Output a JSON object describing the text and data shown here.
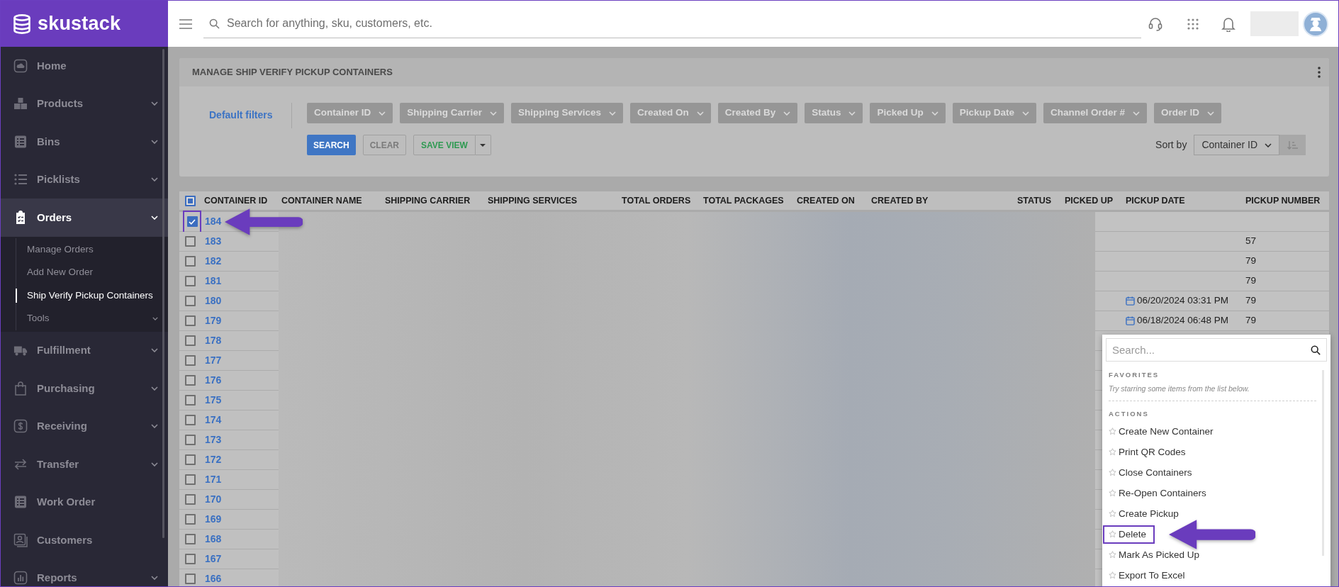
{
  "brand": {
    "name": "skustack"
  },
  "sidebar": {
    "items": [
      {
        "label": "Home",
        "kind": "link",
        "selected": false
      },
      {
        "label": "Products",
        "kind": "group",
        "selected": false
      },
      {
        "label": "Bins",
        "kind": "group",
        "selected": false
      },
      {
        "label": "Picklists",
        "kind": "group",
        "selected": false
      },
      {
        "label": "Orders",
        "kind": "group",
        "selected": true,
        "expanded": true,
        "children": [
          {
            "label": "Manage Orders",
            "kind": "link",
            "selected": false
          },
          {
            "label": "Add New Order",
            "kind": "link",
            "selected": false
          },
          {
            "label": "Ship Verify Pickup Containers",
            "kind": "link",
            "selected": true
          },
          {
            "label": "Tools",
            "kind": "group",
            "selected": false
          }
        ]
      },
      {
        "label": "Fulfillment",
        "kind": "group",
        "selected": false
      },
      {
        "label": "Purchasing",
        "kind": "group",
        "selected": false
      },
      {
        "label": "Receiving",
        "kind": "group",
        "selected": false
      },
      {
        "label": "Transfer",
        "kind": "group",
        "selected": false
      },
      {
        "label": "Work Order",
        "kind": "link",
        "selected": false
      },
      {
        "label": "Customers",
        "kind": "link",
        "selected": false
      },
      {
        "label": "Reports",
        "kind": "group",
        "selected": false
      }
    ]
  },
  "top_bar": {
    "search": {
      "placeholder": "Search for anything, sku, customers, etc."
    }
  },
  "page": {
    "title": "MANAGE SHIP VERIFY PICKUP CONTAINERS",
    "default_filters": "Default filters",
    "filters": [
      "Container ID",
      "Shipping Carrier",
      "Shipping Services",
      "Created On",
      "Created By",
      "Status",
      "Picked Up",
      "Pickup Date",
      "Channel Order #",
      "Order ID"
    ],
    "buttons": [
      {
        "label": "SEARCH",
        "kind": "primary"
      },
      {
        "label": "CLEAR",
        "kind": "outline"
      },
      {
        "label": "SAVE VIEW",
        "kind": "split"
      }
    ],
    "sort": {
      "label": "Sort by",
      "value": "Container ID"
    }
  },
  "table": {
    "header_checkbox": {
      "indeterminate": true
    },
    "columns": [
      "CONTAINER ID",
      "CONTAINER NAME",
      "SHIPPING CARRIER",
      "SHIPPING SERVICES",
      "TOTAL ORDERS",
      "TOTAL PACKAGES",
      "CREATED ON",
      "CREATED BY",
      "STATUS",
      "PICKED UP",
      "PICKUP DATE",
      "PICKUP NUMBER"
    ],
    "rows": [
      {
        "id": "184",
        "checked": true,
        "highlighted": true
      },
      {
        "id": "183",
        "checked": false,
        "highlighted": false,
        "pickup_number": "57"
      },
      {
        "id": "182",
        "checked": false,
        "highlighted": false,
        "pickup_number": "79"
      },
      {
        "id": "181",
        "checked": false,
        "highlighted": false,
        "pickup_number": "79"
      },
      {
        "id": "180",
        "checked": false,
        "highlighted": false,
        "pickup_date": "06/20/2024 03:31 PM",
        "pickup_number": "79"
      },
      {
        "id": "179",
        "checked": false,
        "highlighted": false,
        "pickup_date": "06/18/2024 06:48 PM",
        "pickup_number": "79"
      },
      {
        "id": "178",
        "checked": false,
        "highlighted": false
      },
      {
        "id": "177",
        "checked": false,
        "highlighted": false
      },
      {
        "id": "176",
        "checked": false,
        "highlighted": false
      },
      {
        "id": "175",
        "checked": false,
        "highlighted": false
      },
      {
        "id": "174",
        "checked": false,
        "highlighted": false
      },
      {
        "id": "173",
        "checked": false,
        "highlighted": false
      },
      {
        "id": "172",
        "checked": false,
        "highlighted": false
      },
      {
        "id": "171",
        "checked": false,
        "highlighted": false
      },
      {
        "id": "170",
        "checked": false,
        "highlighted": false
      },
      {
        "id": "169",
        "checked": false,
        "highlighted": false
      },
      {
        "id": "168",
        "checked": false,
        "highlighted": false
      },
      {
        "id": "167",
        "checked": false,
        "highlighted": false
      },
      {
        "id": "166",
        "checked": false,
        "highlighted": false
      }
    ]
  },
  "actions_menu": {
    "search_placeholder": "Search...",
    "favorites_heading": "FAVORITES",
    "favorites_hint": "Try starring some items from the list below.",
    "actions_heading": "ACTIONS",
    "items": [
      {
        "label": "Create New Container",
        "highlighted": false
      },
      {
        "label": "Print QR Codes",
        "highlighted": false
      },
      {
        "label": "Close Containers",
        "highlighted": false
      },
      {
        "label": "Re-Open Containers",
        "highlighted": false
      },
      {
        "label": "Create Pickup",
        "highlighted": false
      },
      {
        "label": "Delete",
        "highlighted": true
      },
      {
        "label": "Mark As Picked Up",
        "highlighted": false
      },
      {
        "label": "Export To Excel",
        "highlighted": false
      }
    ]
  }
}
